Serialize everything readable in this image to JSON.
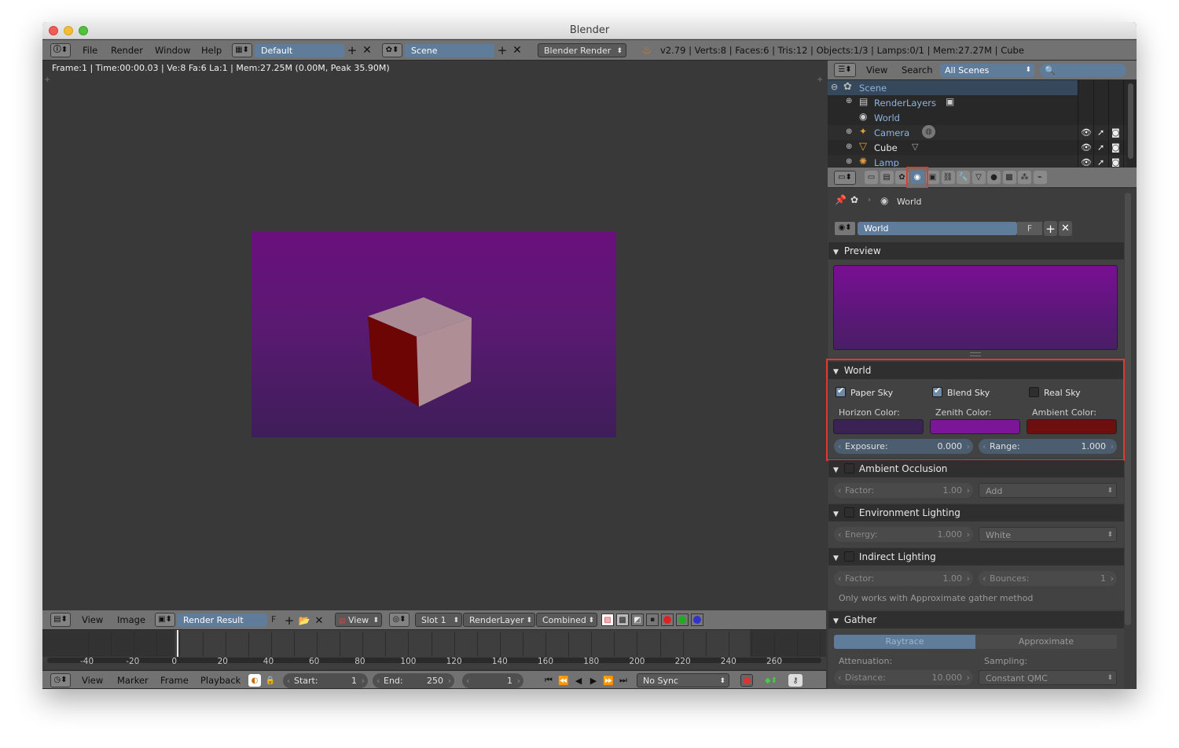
{
  "window": {
    "title": "Blender"
  },
  "info_header": {
    "menus": [
      "File",
      "Render",
      "Window",
      "Help"
    ],
    "screen_layout": "Default",
    "scene": "Scene",
    "engine": "Blender Render",
    "stats": "v2.79 | Verts:8 | Faces:6 | Tris:12 | Objects:1/3 | Lamps:0/1 | Mem:27.27M | Cube"
  },
  "image_editor": {
    "status": "Frame:1 | Time:00:00.03 | Ve:8 Fa:6 La:1 | Mem:27.25M (0.00M, Peak 35.90M)",
    "header": {
      "menus": [
        "View",
        "Image"
      ],
      "image_name": "Render Result",
      "fake_user": "F",
      "view_mode": "View",
      "slot": "Slot 1",
      "render_layer": "RenderLayer",
      "pass": "Combined"
    }
  },
  "outliner": {
    "menus": [
      "View",
      "Search"
    ],
    "display_mode": "All Scenes",
    "rows": [
      {
        "label": "Scene"
      },
      {
        "label": "RenderLayers"
      },
      {
        "label": "World"
      },
      {
        "label": "Camera"
      },
      {
        "label": "Cube"
      },
      {
        "label": "Lamp"
      }
    ]
  },
  "properties": {
    "breadcrumb": "World",
    "world_name": "World",
    "fake_user": "F",
    "panels": {
      "preview": "Preview",
      "world": {
        "title": "World",
        "paper_sky": {
          "label": "Paper Sky",
          "checked": true
        },
        "blend_sky": {
          "label": "Blend Sky",
          "checked": true
        },
        "real_sky": {
          "label": "Real Sky",
          "checked": false
        },
        "horizon_label": "Horizon Color:",
        "zenith_label": "Zenith Color:",
        "ambient_label": "Ambient Color:",
        "horizon_color": "#3a2354",
        "zenith_color": "#7a1796",
        "ambient_color": "#6e0f0f",
        "exposure_label": "Exposure:",
        "exposure_value": "0.000",
        "range_label": "Range:",
        "range_value": "1.000"
      },
      "ambient_occlusion": {
        "title": "Ambient Occlusion",
        "factor_label": "Factor:",
        "factor_value": "1.00",
        "blend": "Add"
      },
      "environment_lighting": {
        "title": "Environment Lighting",
        "energy_label": "Energy:",
        "energy_value": "1.000",
        "color": "White"
      },
      "indirect_lighting": {
        "title": "Indirect Lighting",
        "factor_label": "Factor:",
        "factor_value": "1.00",
        "bounces_label": "Bounces:",
        "bounces_value": "1",
        "note": "Only works with Approximate gather method"
      },
      "gather": {
        "title": "Gather",
        "tabs": [
          "Raytrace",
          "Approximate"
        ],
        "attenuation_label": "Attenuation:",
        "sampling_label": "Sampling:",
        "distance_label": "Distance:",
        "distance_value": "10.000",
        "sampling_value": "Constant QMC"
      }
    }
  },
  "timeline": {
    "ticks": [
      "-40",
      "-20",
      "0",
      "20",
      "40",
      "60",
      "80",
      "100",
      "120",
      "140",
      "160",
      "180",
      "200",
      "220",
      "240",
      "260"
    ],
    "menus": [
      "View",
      "Marker",
      "Frame",
      "Playback"
    ],
    "start_label": "Start:",
    "start_value": "1",
    "end_label": "End:",
    "end_value": "250",
    "current_frame": "1",
    "sync": "No Sync"
  },
  "colors": {
    "accent": "#5f7d9b",
    "highlight_box": "#e03a2e",
    "render_top": "#6a0f7d",
    "render_bottom": "#3e1e58"
  }
}
